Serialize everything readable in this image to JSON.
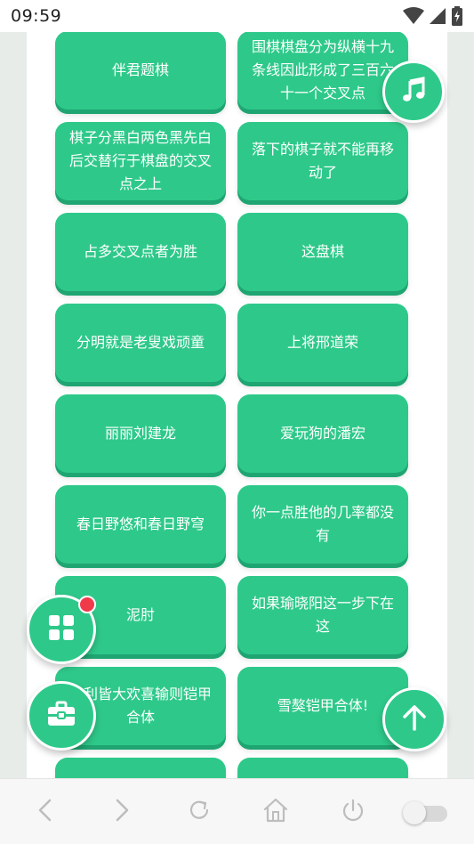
{
  "status_bar": {
    "time": "09:59",
    "icons": [
      "wifi-icon",
      "cellular-signal-icon",
      "battery-charging-icon"
    ]
  },
  "tiles": [
    "伴君题棋",
    "围棋棋盘分为纵横十九条线因此形成了三百六十一个交叉点",
    "棋子分黑白两色黑先白后交替行于棋盘的交叉点之上",
    "落下的棋子就不能再移动了",
    "占多交叉点者为胜",
    "这盘棋",
    "分明就是老叟戏顽童",
    "上将邢道荣",
    "丽丽刘建龙",
    "爱玩狗的潘宏",
    "春日野悠和春日野穹",
    "你一点胜他的几率都没有",
    "泥肘",
    "如果瑜晓阳这一步下在这",
    "胜利皆大欢喜输则铠甲合体",
    "雪獒铠甲合体!"
  ],
  "floating_buttons": {
    "music": "music-note-icon",
    "apps": "grid-icon",
    "toolbox": "toolbox-icon",
    "scroll_up": "arrow-up-icon"
  },
  "nav_bar": {
    "icons": [
      "chevron-left-icon",
      "chevron-right-icon",
      "reload-icon",
      "home-icon",
      "power-icon",
      "toggle-switch"
    ],
    "toggle_state": "off"
  },
  "colors": {
    "tile": "#2ec98a",
    "tile_shadow": "#1fa572",
    "badge": "#f03a4a",
    "page_background": "#e7ece9"
  }
}
